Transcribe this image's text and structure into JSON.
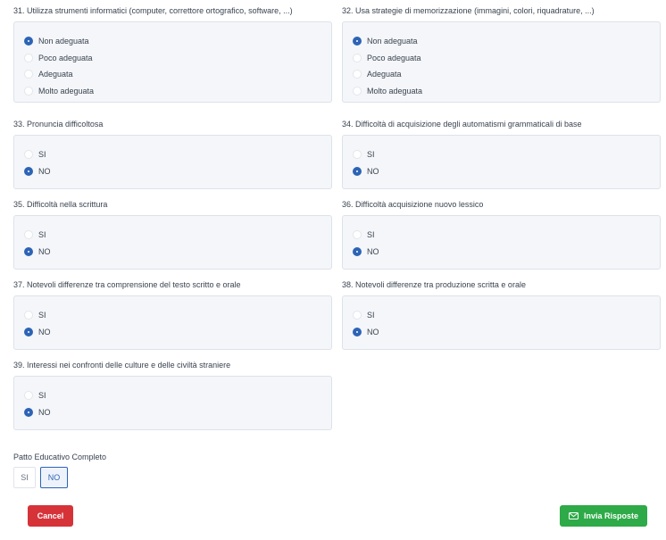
{
  "questions": [
    {
      "label": "31. Utilizza strumenti informatici (computer, correttore ortografico, software, ...)",
      "options": [
        "Non adeguata",
        "Poco adeguata",
        "Adeguata",
        "Molto adeguata"
      ],
      "selected": 0
    },
    {
      "label": "32. Usa strategie di memorizzazione (immagini, colori, riquadrature, ...)",
      "options": [
        "Non adeguata",
        "Poco adeguata",
        "Adeguata",
        "Molto adeguata"
      ],
      "selected": 0
    },
    {
      "label": "33. Pronuncia difficoltosa",
      "options": [
        "SI",
        "NO"
      ],
      "selected": 1
    },
    {
      "label": "34. Difficoltà di acquisizione degli automatismi grammaticali di base",
      "options": [
        "SI",
        "NO"
      ],
      "selected": 1
    },
    {
      "label": "35. Difficoltà nella scrittura",
      "options": [
        "SI",
        "NO"
      ],
      "selected": 1
    },
    {
      "label": "36. Difficoltà acquisizione nuovo lessico",
      "options": [
        "SI",
        "NO"
      ],
      "selected": 1
    },
    {
      "label": "37. Notevoli differenze tra comprensione del testo scritto e orale",
      "options": [
        "SI",
        "NO"
      ],
      "selected": 1
    },
    {
      "label": "38. Notevoli differenze tra produzione scritta e orale",
      "options": [
        "SI",
        "NO"
      ],
      "selected": 1
    },
    {
      "label": "39. Interessi nei confronti delle culture e delle civiltà straniere",
      "options": [
        "SI",
        "NO"
      ],
      "selected": 1
    }
  ],
  "patto": {
    "label": "Patto Educativo Completo",
    "options": [
      "SI",
      "NO"
    ],
    "selected": "NO"
  },
  "buttons": {
    "cancel_label": "Cancel",
    "submit_label": "Invia Risposte",
    "submit_icon": "envelope-icon"
  },
  "colors": {
    "accent": "#2d64b5",
    "cancel": "#d63339",
    "submit": "#2eaa48"
  }
}
